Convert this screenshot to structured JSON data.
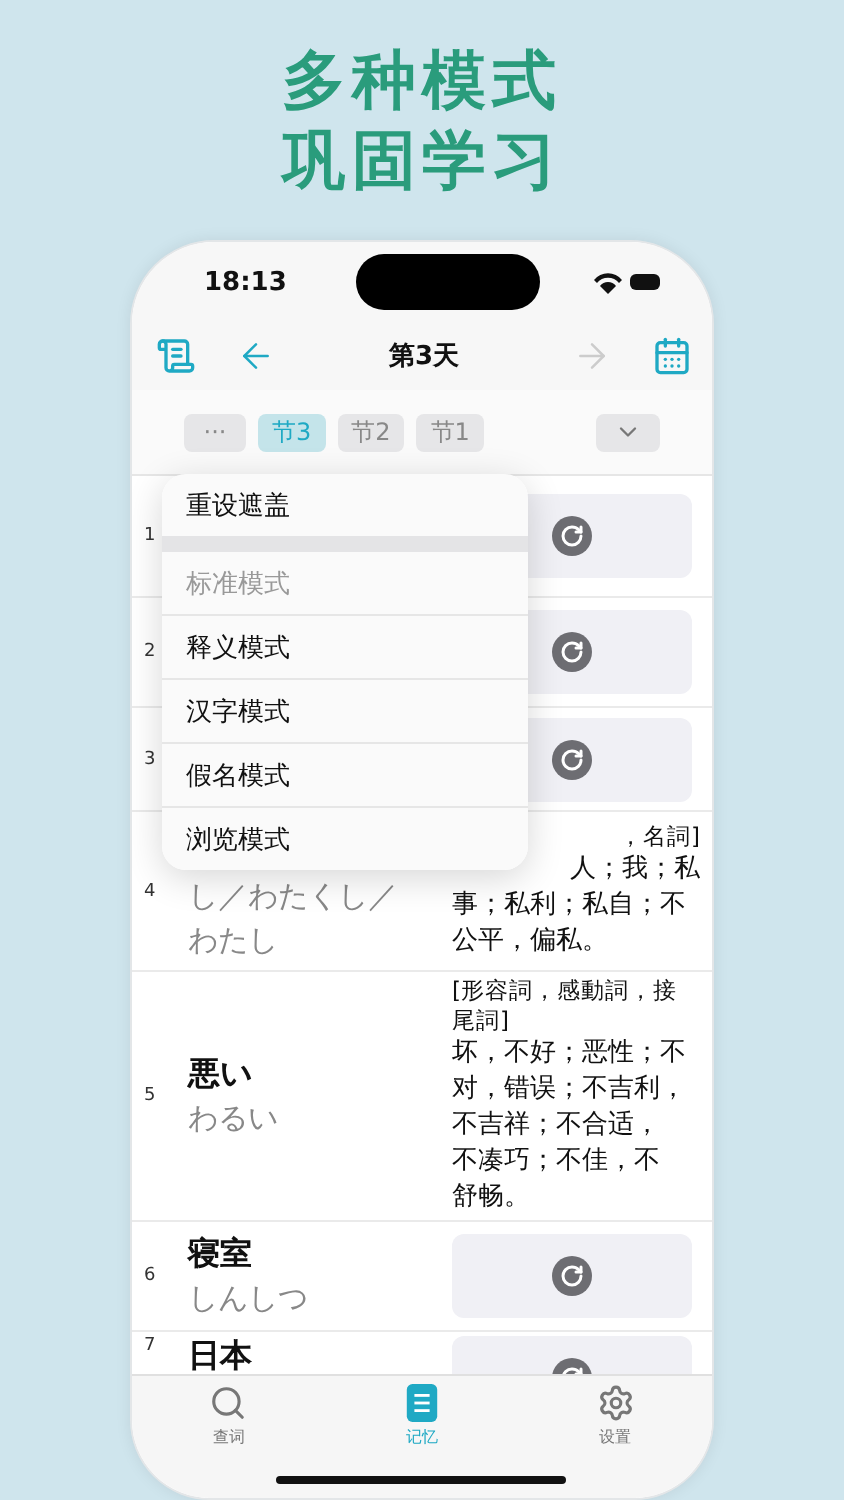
{
  "headline": [
    "多种模式",
    "巩固学习"
  ],
  "status_bar": {
    "time": "18:13"
  },
  "nav": {
    "title": "第3天",
    "back_disabled": false,
    "forward_disabled": true
  },
  "more_button": {
    "label": "···"
  },
  "sections": [
    {
      "label": "节3",
      "selected": true
    },
    {
      "label": "节2",
      "selected": false
    },
    {
      "label": "节1",
      "selected": false
    }
  ],
  "menu": {
    "actions": [
      {
        "label": "重设遮盖",
        "disabled": false
      }
    ],
    "modes": [
      {
        "label": "标准模式",
        "disabled": true
      },
      {
        "label": "释义模式",
        "disabled": false
      },
      {
        "label": "汉字模式",
        "disabled": false
      },
      {
        "label": "假名模式",
        "disabled": false
      },
      {
        "label": "浏览模式",
        "disabled": false
      }
    ]
  },
  "rows": [
    {
      "number": "1",
      "kind": "covered"
    },
    {
      "number": "2",
      "kind": "covered"
    },
    {
      "number": "3",
      "kind": "covered"
    },
    {
      "number": "4",
      "kind": "partial",
      "reading_lines": [
        "し／わたくし／",
        "わたし"
      ],
      "pos_fragment": "，名詞]",
      "meaning_fragment": "人；我；私",
      "meaning_lines": [
        "事；私利；私自；不",
        "公平，偏私。"
      ]
    },
    {
      "number": "5",
      "kind": "shown",
      "word": "悪い",
      "reading_lines": [
        "わるい"
      ],
      "pos_lines": [
        "[形容詞，感動詞，接",
        "尾詞]"
      ],
      "meaning_lines": [
        "坏，不好；恶性；不",
        "对，错误；不吉利，",
        "不吉祥；不合适，",
        "不凑巧；不佳，不",
        "舒畅。"
      ]
    },
    {
      "number": "6",
      "kind": "covered",
      "word": "寝室",
      "reading_lines": [
        "しんしつ"
      ]
    },
    {
      "number": "7",
      "kind": "covered",
      "word": "日本"
    }
  ],
  "tabs": [
    {
      "label": "查词",
      "selected": false
    },
    {
      "label": "记忆",
      "selected": true
    },
    {
      "label": "设置",
      "selected": false
    }
  ]
}
